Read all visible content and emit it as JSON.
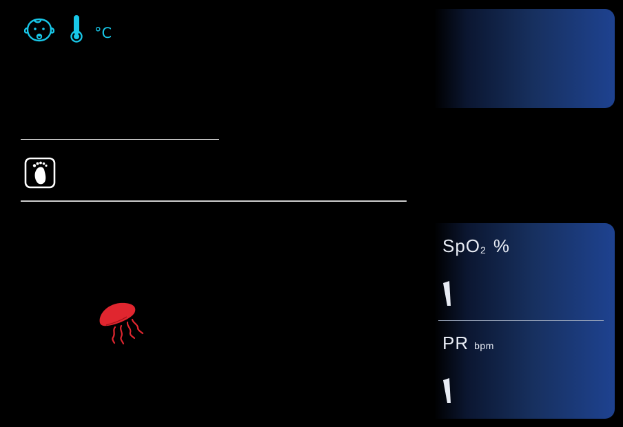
{
  "header": {
    "temperature_unit": "°C",
    "icons": [
      "baby-face-icon",
      "thermometer-icon"
    ]
  },
  "left": {
    "icons": [
      "foot-icon",
      "jellyfish-icon"
    ]
  },
  "vitals": {
    "spo2": {
      "label": "SpO",
      "label_sub": "2",
      "unit": "%"
    },
    "pr": {
      "label": "PR",
      "unit": "bpm"
    }
  },
  "colors": {
    "accent_cyan": "#18c7e8",
    "alert_red": "#e0262f",
    "panel_gradient_end": "#1e4290",
    "background": "#000000"
  }
}
